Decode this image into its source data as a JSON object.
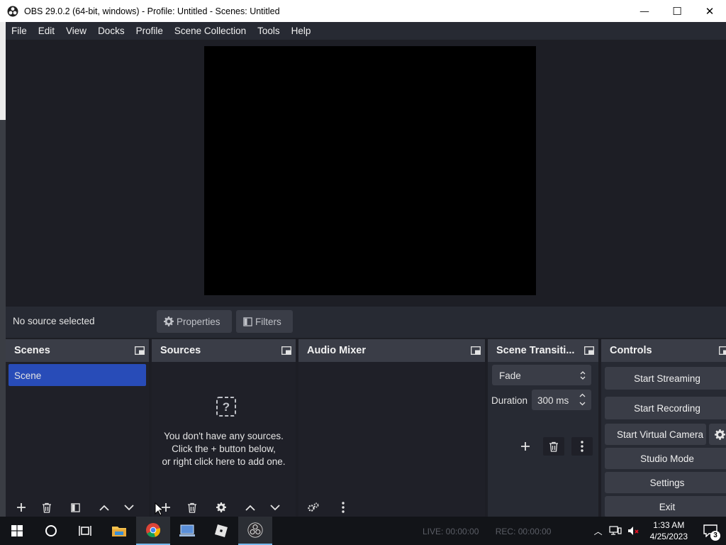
{
  "window": {
    "title": "OBS 29.0.2 (64-bit, windows) - Profile: Untitled - Scenes: Untitled",
    "minimize": "—",
    "maximize": "☐",
    "close": "✕"
  },
  "menu": [
    "File",
    "Edit",
    "View",
    "Docks",
    "Profile",
    "Scene Collection",
    "Tools",
    "Help"
  ],
  "context_bar": {
    "status": "No source selected",
    "properties_label": "Properties",
    "filters_label": "Filters"
  },
  "scenes_dock": {
    "title": "Scenes",
    "items": [
      "Scene"
    ]
  },
  "sources_dock": {
    "title": "Sources",
    "empty_line1": "You don't have any sources.",
    "empty_line2": "Click the + button below,",
    "empty_line3": "or right click here to add one."
  },
  "mixer_dock": {
    "title": "Audio Mixer"
  },
  "transitions_dock": {
    "title": "Scene Transiti...",
    "transition": "Fade",
    "duration_label": "Duration",
    "duration_value": "300 ms"
  },
  "controls_dock": {
    "title": "Controls",
    "start_streaming": "Start Streaming",
    "start_recording": "Start Recording",
    "start_virtual_camera": "Start Virtual Camera",
    "studio_mode": "Studio Mode",
    "settings": "Settings",
    "exit": "Exit"
  },
  "status": {
    "live": "LIVE: 00:00:00",
    "rec": "REC: 00:00:00"
  },
  "taskbar": {
    "time": "1:33 AM",
    "date": "4/25/2023",
    "notifications": "3"
  },
  "colors": {
    "accent": "#284cb8",
    "dock_bg": "#272a33",
    "header_bg": "#3a3d47",
    "app_bg": "#1d1e25"
  }
}
